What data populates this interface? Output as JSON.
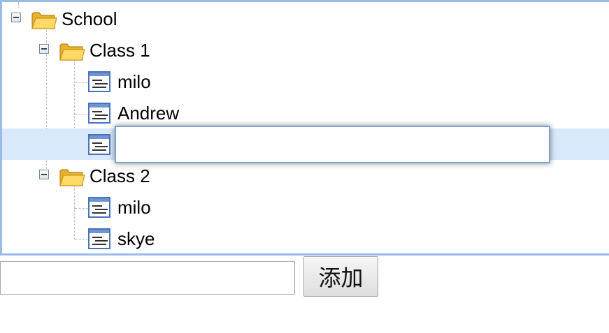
{
  "tree": {
    "root": {
      "label": "School",
      "icon": "folder-open-icon",
      "toggle_icon": "collapse-minus-icon"
    },
    "class1": {
      "label": "Class 1",
      "icon": "folder-open-icon",
      "children": [
        {
          "label": "milo",
          "icon": "leaf-node-icon"
        },
        {
          "label": "Andrew",
          "icon": "leaf-node-icon"
        },
        {
          "label": "",
          "icon": "leaf-node-icon",
          "editing": true
        }
      ]
    },
    "class2": {
      "label": "Class 2",
      "icon": "folder-open-icon",
      "children": [
        {
          "label": "milo",
          "icon": "leaf-node-icon"
        },
        {
          "label": "skye",
          "icon": "leaf-node-icon"
        }
      ]
    },
    "edit_value": ""
  },
  "form": {
    "input_value": "",
    "add_label": "添加"
  },
  "colors": {
    "panel_border": "#99bbe8",
    "selected_row": "#dae8fc",
    "folder_yellow": "#f6c844",
    "leaf_icon_blue": "#4a72b8"
  }
}
